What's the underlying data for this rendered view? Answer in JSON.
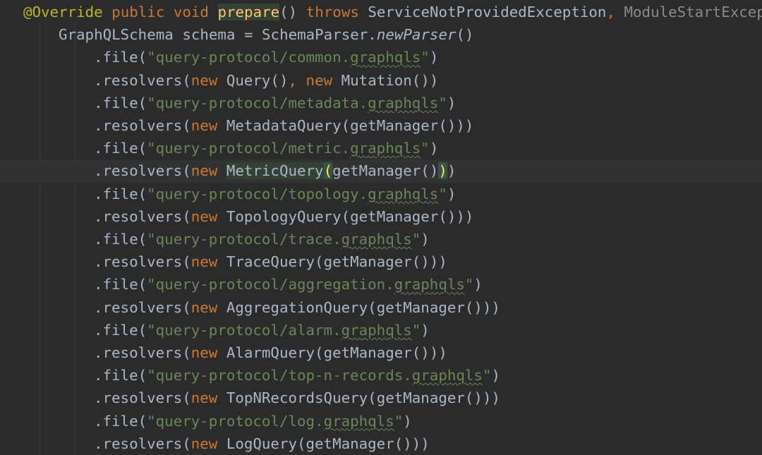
{
  "header_line": {
    "annotation": "@Override",
    "public": "public",
    "void": "void",
    "method_name": "prepare",
    "parens": "()",
    "throws": "throws",
    "exception1": "ServiceNotProvidedException",
    "comma": ",",
    "exception2": "ModuleStartExcept"
  },
  "schema_line": {
    "type": "GraphQLSchema",
    "var": "schema",
    "assign": "=",
    "parser_class": "SchemaParser.",
    "parser_method": "newParser",
    "close": "()"
  },
  "keywords": {
    "new": "new"
  },
  "common": {
    "file_open": ".file(",
    "resolvers_open": ".resolvers(",
    "ext": "graphqls",
    "quote": "\"",
    "close": ")"
  },
  "lines": [
    {
      "kind": "file",
      "path": "query-protocol/common."
    },
    {
      "kind": "resolvers_double",
      "first": "Query()",
      "comma": ",",
      "second": "Mutation())"
    },
    {
      "kind": "file",
      "path": "query-protocol/metadata."
    },
    {
      "kind": "resolvers",
      "class": "MetadataQuery",
      "args": "(getManager()))"
    },
    {
      "kind": "file",
      "path": "query-protocol/metric."
    },
    {
      "kind": "resolvers_current",
      "class": "MetricQuery",
      "open_paren": "(",
      "inner": "getManager()",
      "close_paren": ")",
      "tail": ")"
    },
    {
      "kind": "file",
      "path": "query-protocol/topology."
    },
    {
      "kind": "resolvers",
      "class": "TopologyQuery",
      "args": "(getManager()))"
    },
    {
      "kind": "file",
      "path": "query-protocol/trace."
    },
    {
      "kind": "resolvers",
      "class": "TraceQuery",
      "args": "(getManager()))"
    },
    {
      "kind": "file",
      "path": "query-protocol/aggregation."
    },
    {
      "kind": "resolvers",
      "class": "AggregationQuery",
      "args": "(getManager()))"
    },
    {
      "kind": "file",
      "path": "query-protocol/alarm."
    },
    {
      "kind": "resolvers",
      "class": "AlarmQuery",
      "args": "(getManager()))"
    },
    {
      "kind": "file",
      "path": "query-protocol/top-n-records."
    },
    {
      "kind": "resolvers",
      "class": "TopNRecordsQuery",
      "args": "(getManager()))"
    },
    {
      "kind": "file",
      "path": "query-protocol/log."
    },
    {
      "kind": "resolvers",
      "class": "LogQuery",
      "args": "(getManager()))"
    }
  ],
  "colors": {
    "background": "#2b2b2b",
    "current_line": "#323232",
    "default_text": "#a9b7c6",
    "keyword": "#cc7832",
    "string": "#6a8759",
    "annotation": "#bbb529",
    "method_decl": "#ffc66d",
    "brace_match": "#ffef28"
  }
}
